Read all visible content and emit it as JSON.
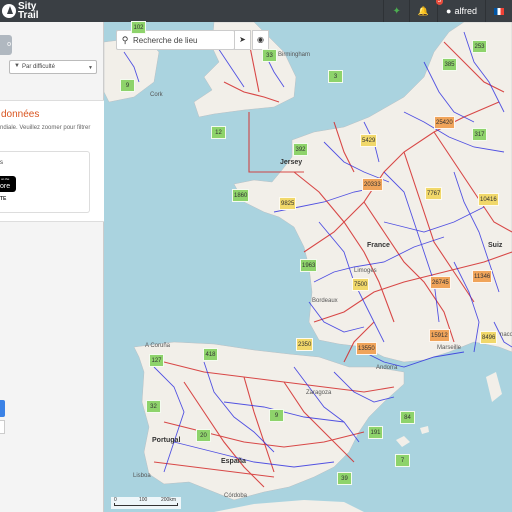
{
  "topbar": {
    "logo_top": "Sity",
    "logo_bottom": "Trail",
    "notification_count": "5",
    "username": "alfred"
  },
  "sidebar": {
    "pill_text": "o",
    "filter_label": "Par difficulté",
    "panel_title": "données",
    "panel_desc": "ndiale. Veuillez zoomer pour filtrer",
    "box_marker": "s",
    "store_small": "on the",
    "store_big": "ore",
    "box_footer": "TE"
  },
  "search": {
    "placeholder": "Recherche de lieu"
  },
  "clusters": [
    {
      "label": "102",
      "cls": "g"
    },
    {
      "label": "33",
      "cls": "g"
    },
    {
      "label": "253",
      "cls": "g"
    },
    {
      "label": "9",
      "cls": "g"
    },
    {
      "label": "3",
      "cls": "g"
    },
    {
      "label": "385",
      "cls": "g"
    },
    {
      "label": "12",
      "cls": "g"
    },
    {
      "label": "25420",
      "cls": "o"
    },
    {
      "label": "317",
      "cls": "g"
    },
    {
      "label": "392",
      "cls": "g"
    },
    {
      "label": "5429",
      "cls": "y"
    },
    {
      "label": "20333",
      "cls": "o"
    },
    {
      "label": "7767",
      "cls": "y"
    },
    {
      "label": "10416",
      "cls": "y"
    },
    {
      "label": "1860",
      "cls": "g"
    },
    {
      "label": "9825",
      "cls": "y"
    },
    {
      "label": "1963",
      "cls": "g"
    },
    {
      "label": "11346",
      "cls": "o"
    },
    {
      "label": "26745",
      "cls": "o"
    },
    {
      "label": "7500",
      "cls": "y"
    },
    {
      "label": "15912",
      "cls": "o"
    },
    {
      "label": "8496",
      "cls": "y"
    },
    {
      "label": "2350",
      "cls": "y"
    },
    {
      "label": "13550",
      "cls": "o"
    },
    {
      "label": "418",
      "cls": "g"
    },
    {
      "label": "127",
      "cls": "g"
    },
    {
      "label": "32",
      "cls": "g"
    },
    {
      "label": "84",
      "cls": "g"
    },
    {
      "label": "9",
      "cls": "g"
    },
    {
      "label": "191",
      "cls": "g"
    },
    {
      "label": "20",
      "cls": "g"
    },
    {
      "label": "7",
      "cls": "g"
    },
    {
      "label": "39",
      "cls": "g"
    }
  ],
  "places": {
    "birmingham": "Birmingham",
    "cork": "Cork",
    "jersey": "Jersey",
    "france": "France",
    "limoges": "Limoges",
    "bordeaux": "Bordeaux",
    "marseille": "Marseille",
    "acoruna": "A Coruña",
    "zaragoza": "Zaragoza",
    "portugal": "Portugal",
    "espana": "España",
    "lisboa": "Lisboa",
    "cordoba": "Córdoba",
    "andorra": "Andorra",
    "suiza": "Suiz",
    "naco": "naco"
  },
  "scale": {
    "s0": "0",
    "s1": "100",
    "s2": "200km"
  },
  "colors": {
    "sea": "#aad3df",
    "land": "#f2efe9",
    "route_red": "#d42b2b",
    "route_blue": "#2a2ae0"
  }
}
